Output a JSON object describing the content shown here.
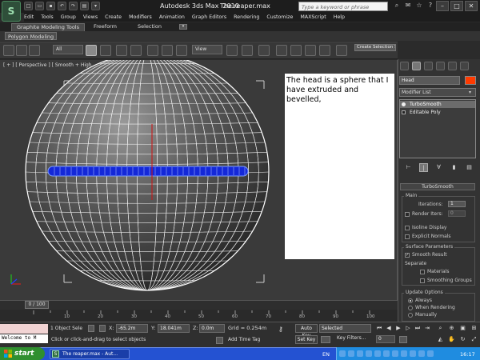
{
  "window": {
    "app_title": "Autodesk 3ds Max  2010",
    "file_title": "The reaper.max",
    "help_placeholder": "Type a keyword or phrase"
  },
  "menu": [
    "Edit",
    "Tools",
    "Group",
    "Views",
    "Create",
    "Modifiers",
    "Animation",
    "Graph Editors",
    "Rendering",
    "Customize",
    "MAXScript",
    "Help"
  ],
  "ribbon": {
    "tabs": [
      "Graphite Modeling Tools",
      "Freeform",
      "Selection"
    ],
    "panel_label": "Polygon Modeling"
  },
  "toolbar": {
    "filter": "All",
    "ref_coord": "View",
    "selection_set": "Create Selection Se"
  },
  "viewport": {
    "label": "[ + ] [ Perspective ] [ Smooth + High",
    "note": "The head is a sphere that I have extruded and bevelled,"
  },
  "command_panel": {
    "object_name": "Head",
    "object_color": "#ff3a00",
    "modifier_list": "Modifier List",
    "stack": [
      "TurboSmooth",
      "Editable Poly"
    ],
    "rollout_title": "TurboSmooth",
    "main": {
      "title": "Main",
      "iterations_label": "Iterations:",
      "iterations_value": "1",
      "render_iters_label": "Render Iters:",
      "render_iters_value": "0",
      "isoline_display": "Isoline Display",
      "explicit_normals": "Explicit Normals"
    },
    "surface": {
      "title": "Surface Parameters",
      "smooth_result": "Smooth Result",
      "separate": "Separate",
      "materials": "Materials",
      "smoothing_groups": "Smoothing Groups"
    },
    "update": {
      "title": "Update Options",
      "always": "Always",
      "when_rendering": "When Rendering",
      "manually": "Manually"
    }
  },
  "timeline": {
    "slider": "0 / 100",
    "ticks": [
      "10",
      "20",
      "30",
      "40",
      "50",
      "60",
      "70",
      "80",
      "90",
      "100"
    ]
  },
  "status": {
    "listener": "Welcome to M",
    "selection": "1 Object Sele",
    "prompt": "Click or click-and-drag to select objects",
    "x_label": "X:",
    "x_value": "-65.2m",
    "y_label": "Y:",
    "y_value": "18.041m",
    "z_label": "Z:",
    "z_value": "0.0m",
    "grid": "Grid = 0.254m",
    "add_time_tag": "Add Time Tag",
    "auto_key": "Auto Key",
    "set_key": "Set Key",
    "selected": "Selected",
    "key_filters": "Key Filters...",
    "frame": "0"
  },
  "taskbar": {
    "start": "start",
    "task": "The reaper.max - Aut...",
    "lang": "EN",
    "clock": "16:17"
  }
}
